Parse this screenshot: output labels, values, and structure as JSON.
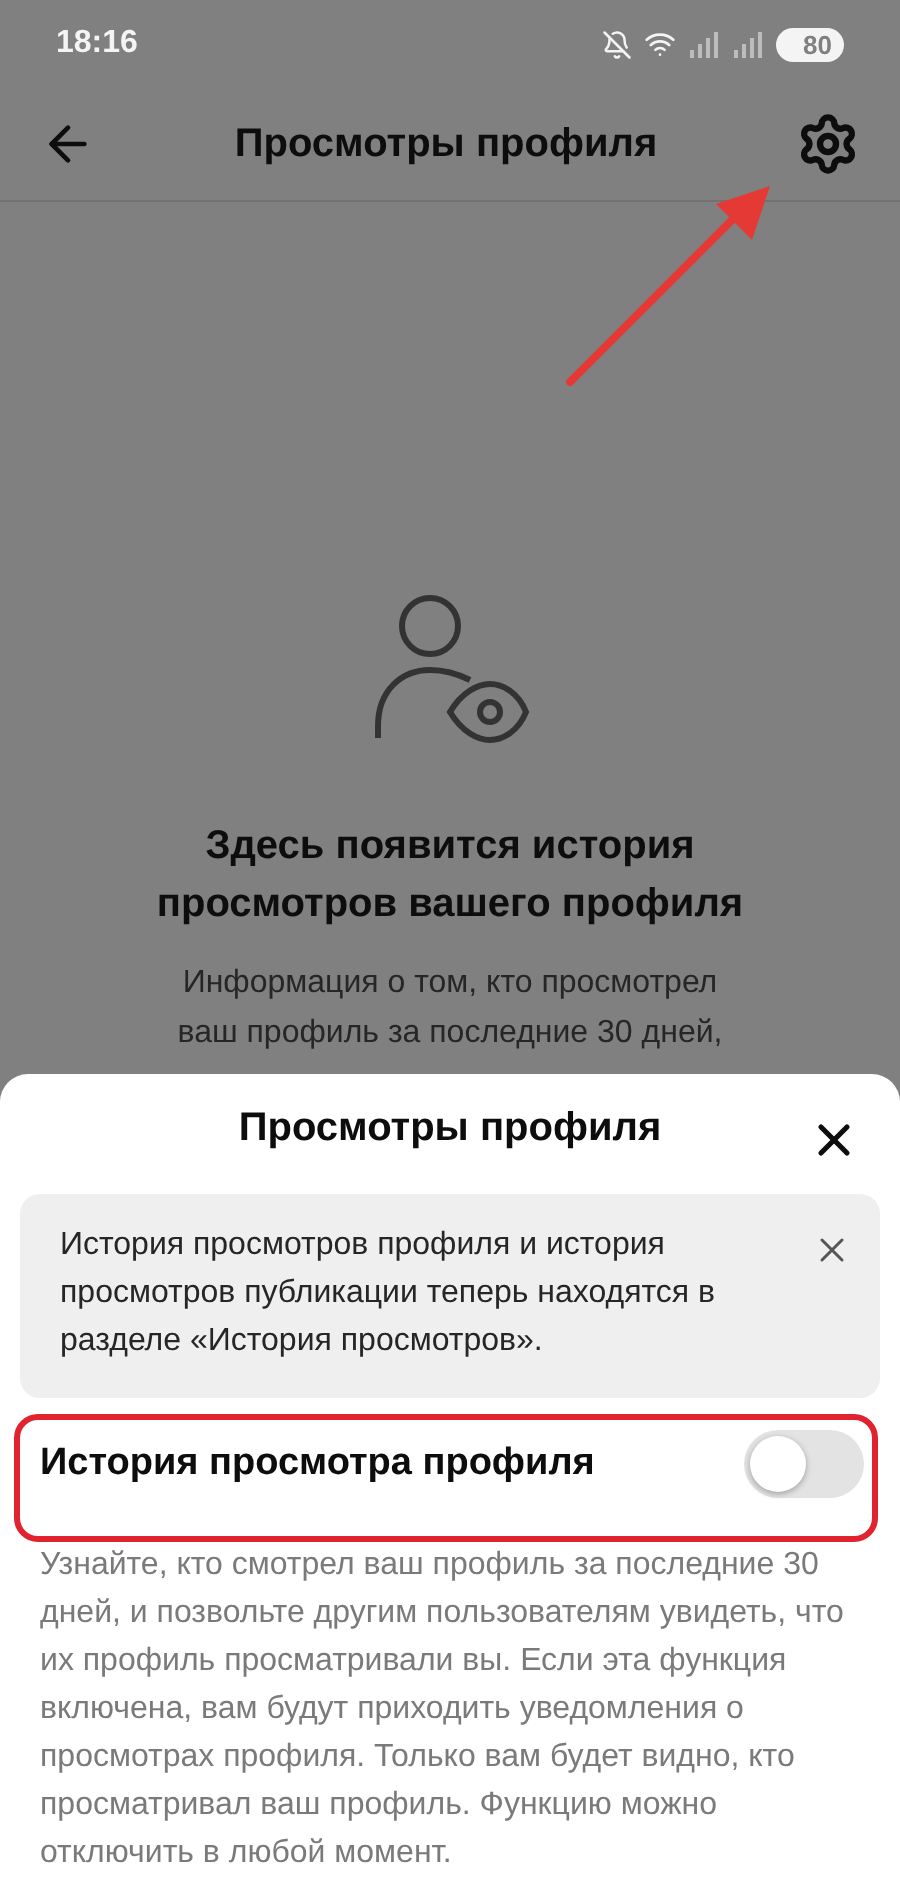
{
  "status_bar": {
    "time": "18:16",
    "battery": "80"
  },
  "header": {
    "title": "Просмотры профиля"
  },
  "empty_state": {
    "heading": "Здесь появится история просмотров вашего профиля",
    "body": "Информация о том, кто просмотрел ваш профиль за последние 30 дней,"
  },
  "sheet": {
    "title": "Просмотры профиля",
    "notice": {
      "text": "История просмотров профиля и история просмотров публикации теперь находятся в разделе «История просмотров»."
    },
    "setting": {
      "label": "История просмотра профиля",
      "on": false,
      "description": "Узнайте, кто смотрел ваш профиль за последние 30 дней, и позвольте другим пользователям увидеть, что их профиль просматривали вы. Если эта функция включена, вам будут приходить уведомления о просмотрах профиля. Только вам будет видно, кто просматривал ваш профиль. Функцию можно отключить в любой момент."
    }
  }
}
